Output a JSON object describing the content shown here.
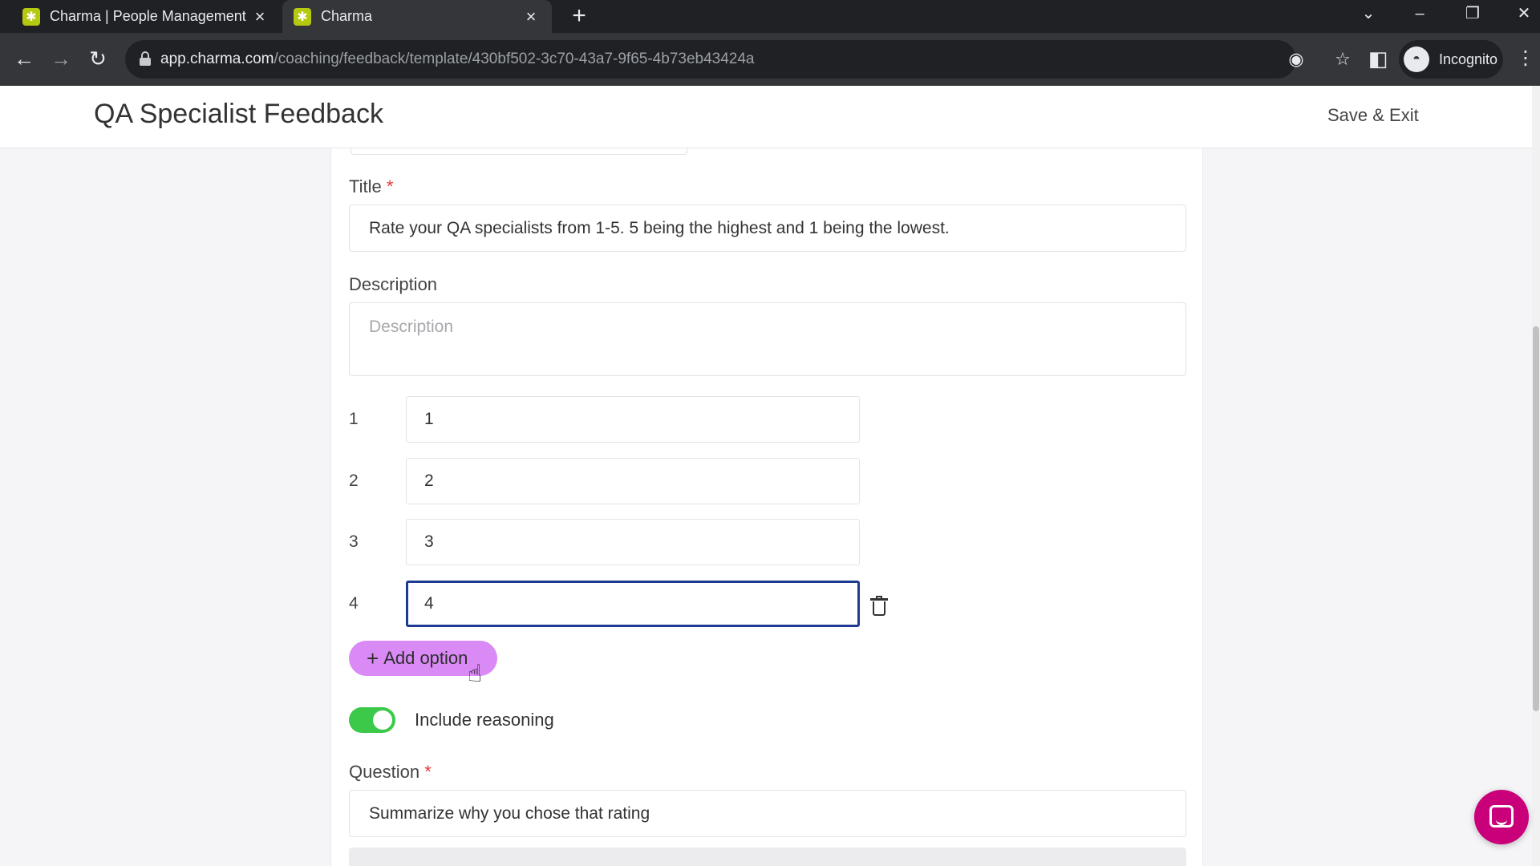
{
  "browser": {
    "tabs": [
      {
        "title": "Charma | People Management S",
        "active": false
      },
      {
        "title": "Charma",
        "active": true
      }
    ],
    "new_tab": "+",
    "url_host": "app.charma.com",
    "url_path": "/coaching/feedback/template/430bf502-3c70-43a7-9f65-4b73eb43424a",
    "profile_label": "Incognito"
  },
  "header": {
    "title": "QA Specialist Feedback",
    "save_exit": "Save & Exit"
  },
  "form": {
    "title_label": "Title",
    "required_mark": "*",
    "title_value": "Rate your QA specialists from 1-5. 5 being the highest and 1 being the lowest.",
    "description_label": "Description",
    "description_placeholder": "Description",
    "options": [
      {
        "number": "1",
        "value": "1"
      },
      {
        "number": "2",
        "value": "2"
      },
      {
        "number": "3",
        "value": "3"
      },
      {
        "number": "4",
        "value": "4"
      }
    ],
    "add_option": "Add option",
    "add_option_icon": "+",
    "include_reasoning_label": "Include reasoning",
    "include_reasoning_enabled": true,
    "question_label": "Question",
    "question_value": "Summarize why you chose that rating"
  },
  "colors": {
    "accent_button": "#d98af5",
    "toggle_on": "#3cc94a",
    "focus_border": "#1f3a93",
    "required": "#e53935",
    "chat_launcher": "#c9007a"
  }
}
